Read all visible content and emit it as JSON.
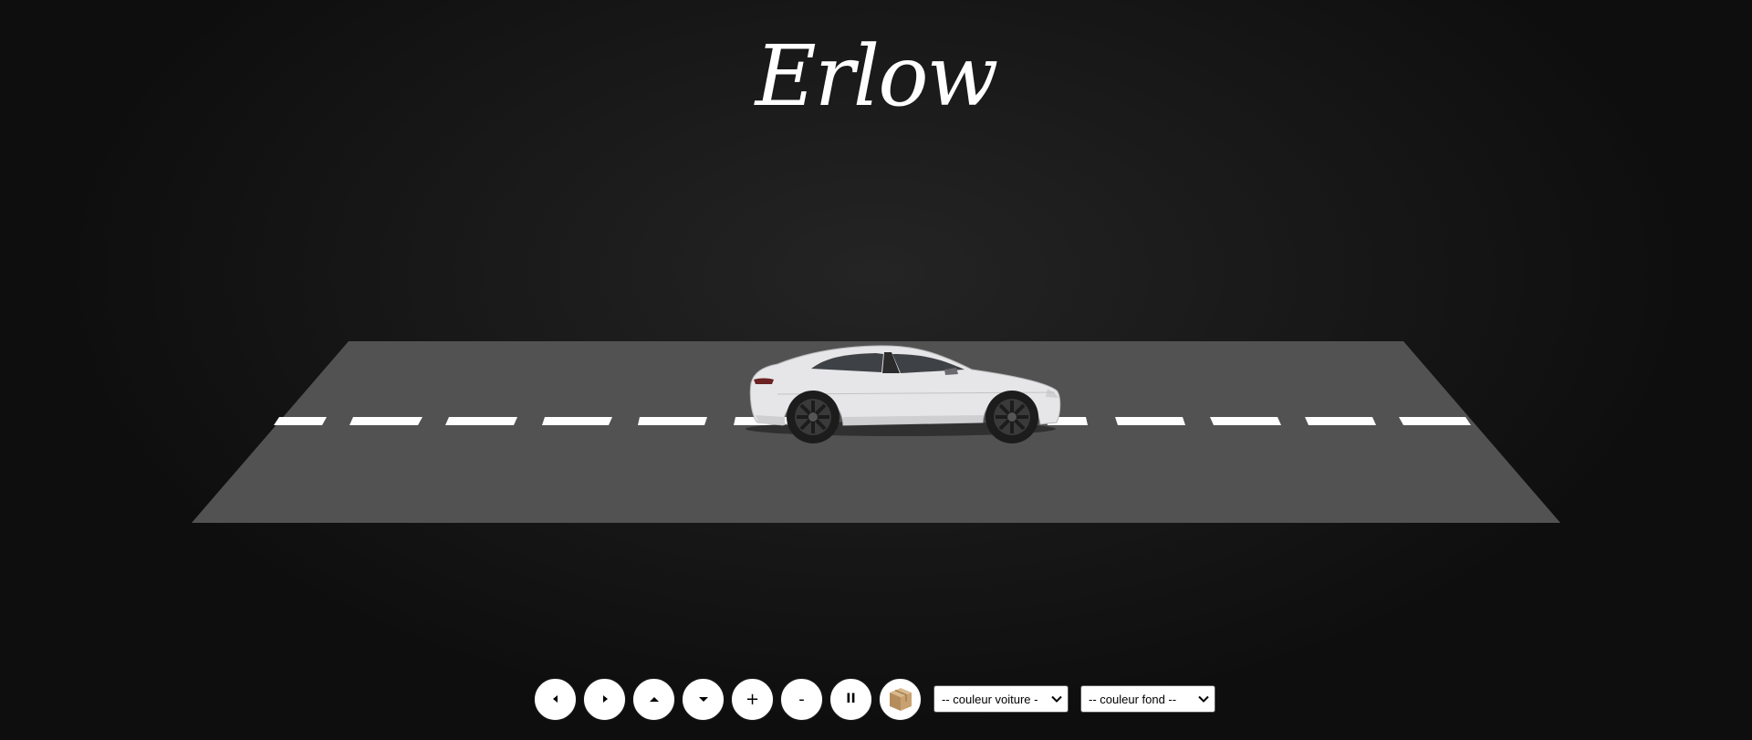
{
  "header": {
    "title": "Erlow"
  },
  "scene": {
    "road_color": "#525252",
    "marking_color": "#ffffff",
    "car_color": "#e8e8ea"
  },
  "controls": {
    "buttons": [
      {
        "icon": "triangle-left-icon"
      },
      {
        "icon": "triangle-right-icon"
      },
      {
        "icon": "triangle-up-icon"
      },
      {
        "icon": "triangle-down-icon"
      },
      {
        "label": "+"
      },
      {
        "label": "-"
      },
      {
        "label": "II"
      },
      {
        "icon": "box-icon"
      }
    ],
    "car_color_select": {
      "selected": "-- couleur voiture -"
    },
    "background_color_select": {
      "selected": "-- couleur fond --"
    }
  }
}
